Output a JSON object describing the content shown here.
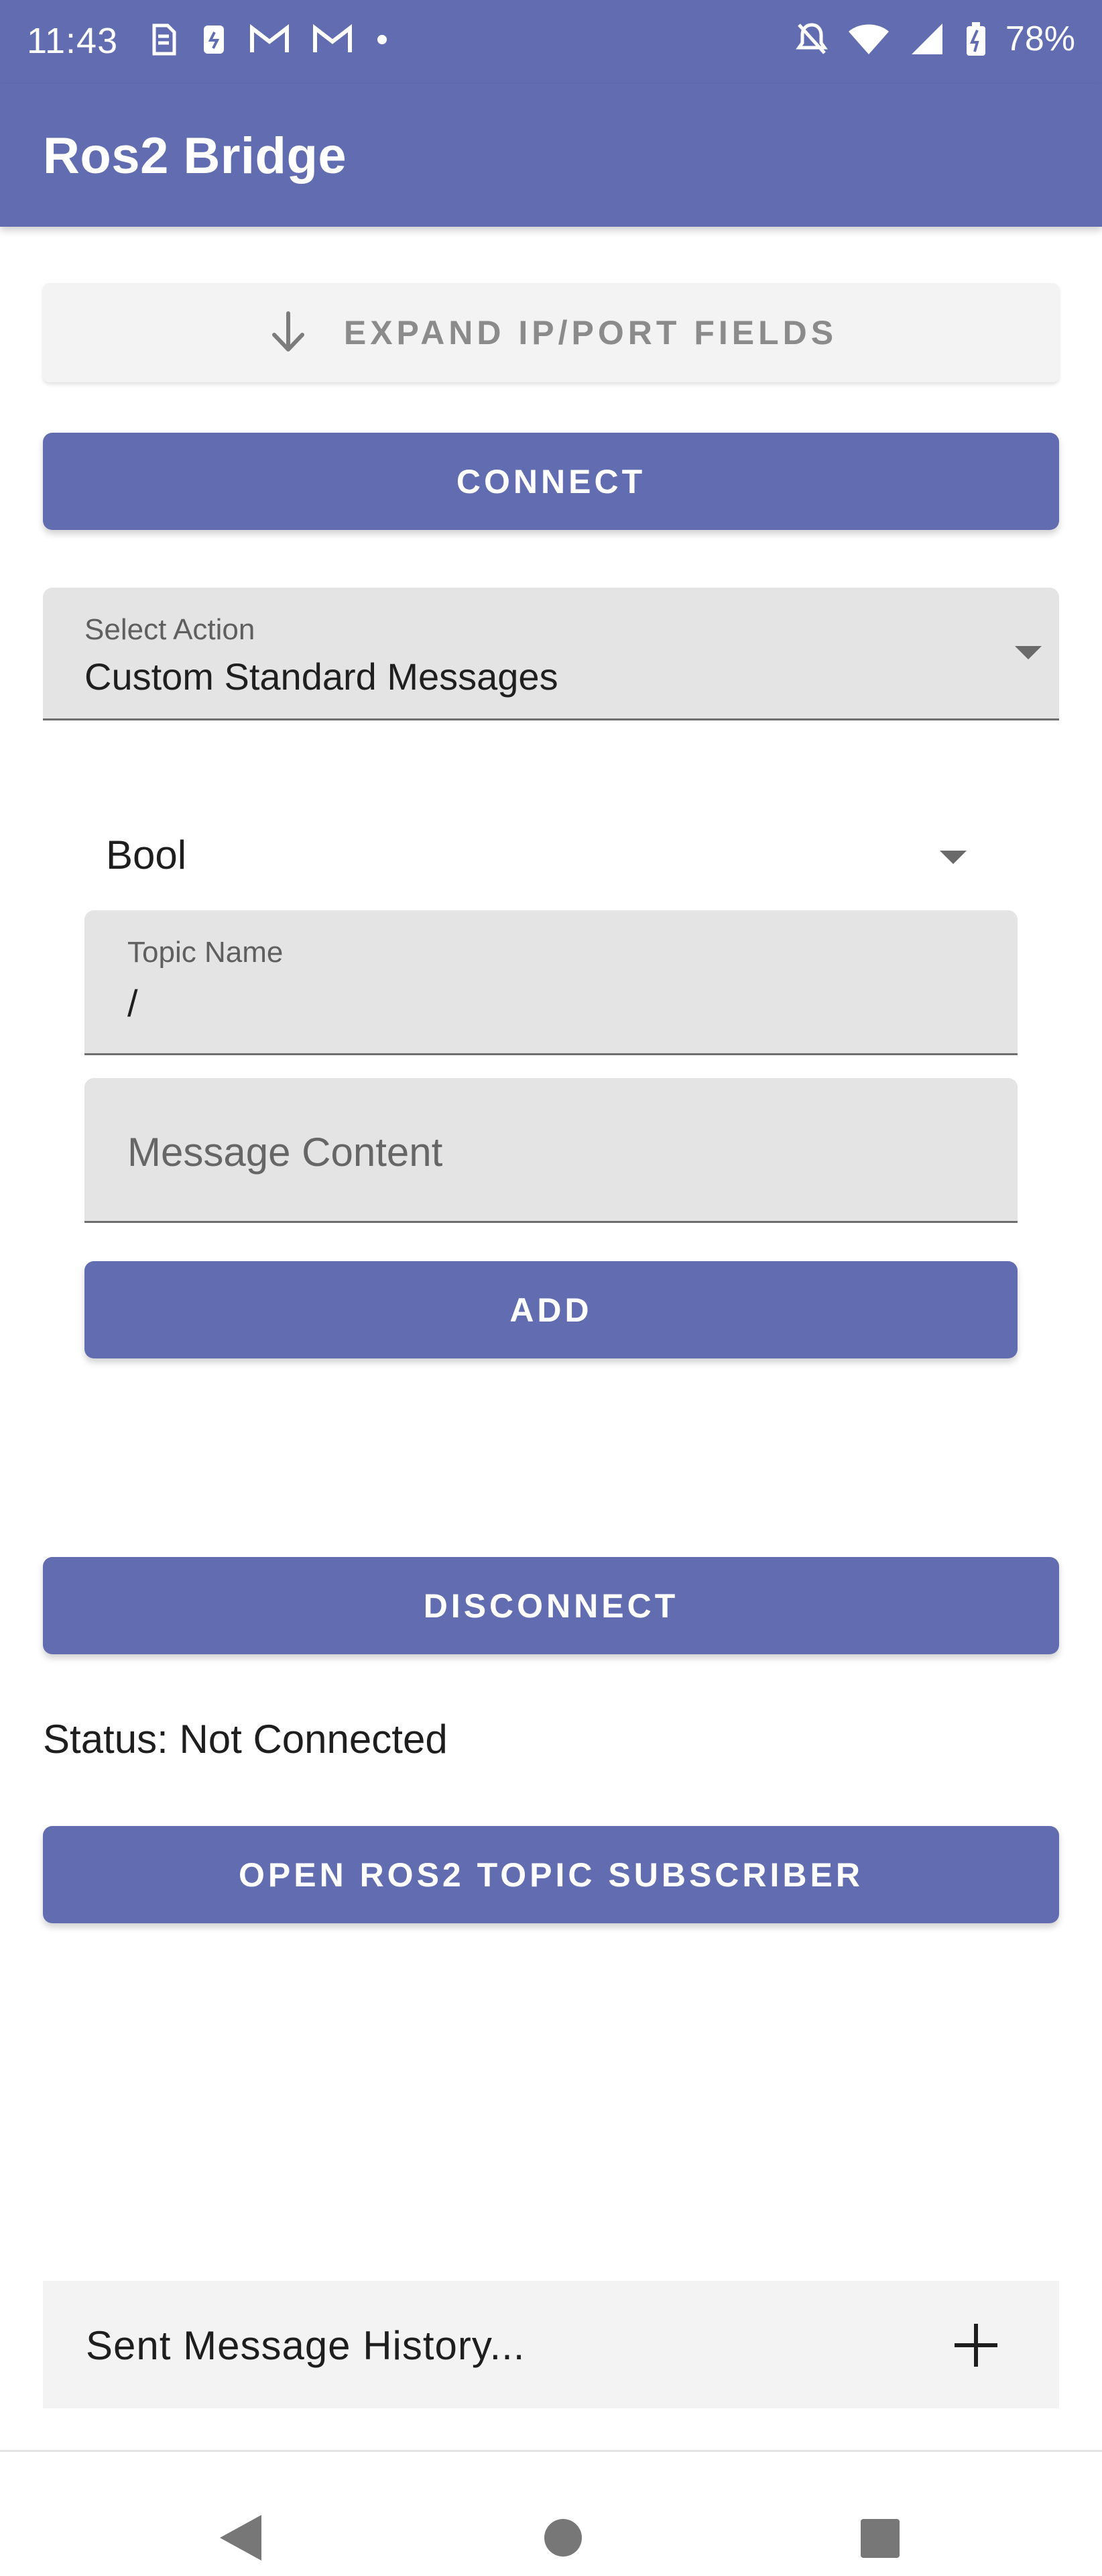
{
  "status_bar": {
    "time": "11:43",
    "battery": "78%",
    "left_icons": [
      "sim-icon",
      "app-icon",
      "gmail-icon",
      "gmail-icon",
      "dot-icon"
    ],
    "right_icons": [
      "mute-icon",
      "wifi-icon",
      "signal-icon",
      "battery-icon"
    ]
  },
  "app_bar": {
    "title": "Ros2 Bridge"
  },
  "buttons": {
    "expand": "EXPAND IP/PORT FIELDS",
    "connect": "CONNECT",
    "add": "ADD",
    "disconnect": "DISCONNECT",
    "subscriber": "OPEN ROS2 TOPIC SUBSCRIBER"
  },
  "select_action": {
    "label": "Select Action",
    "value": "Custom Standard Messages"
  },
  "message_type": {
    "value": "Bool"
  },
  "topic_name": {
    "label": "Topic Name",
    "value": "/"
  },
  "message_content": {
    "placeholder": "Message Content"
  },
  "status": {
    "text": "Status: Not Connected"
  },
  "history": {
    "label": "Sent Message History..."
  },
  "colors": {
    "primary": "#616db0",
    "field_bg": "#e4e4e4"
  }
}
